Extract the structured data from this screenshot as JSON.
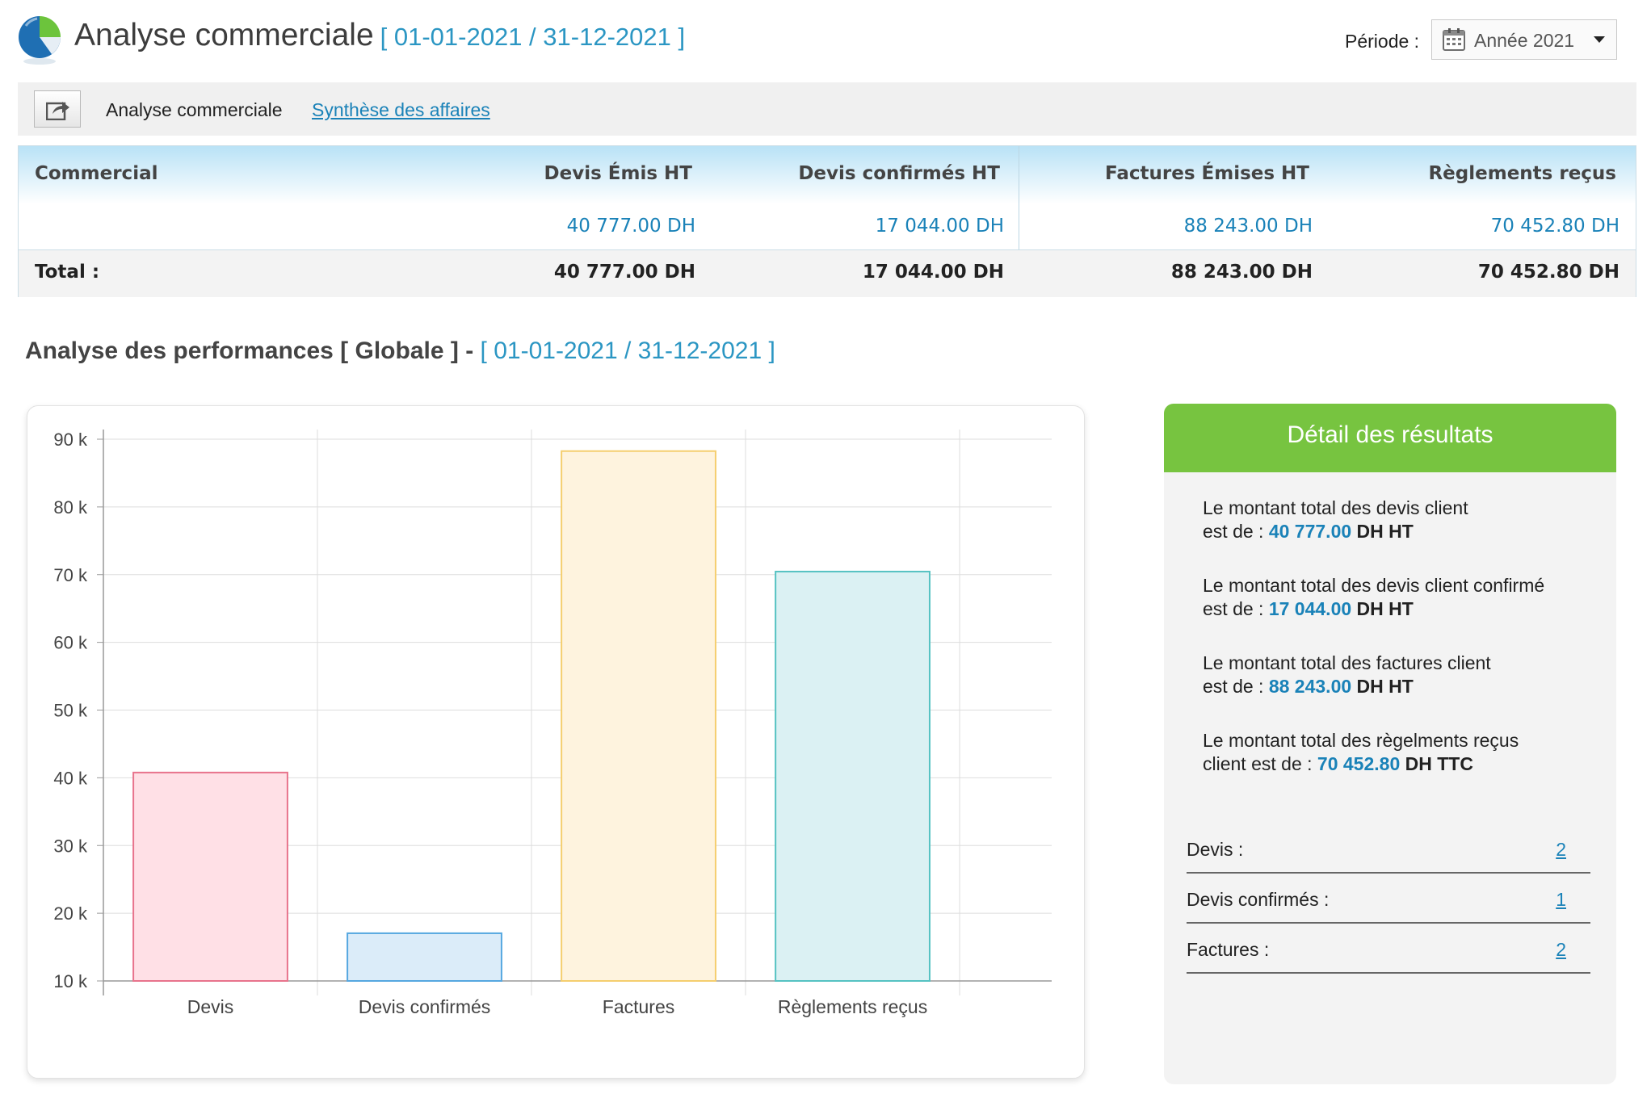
{
  "header": {
    "title": "Analyse commerciale",
    "date_range": "[ 01-01-2021 / 31-12-2021 ]",
    "period_label": "Période :",
    "period_value": "Année 2021"
  },
  "toolbar": {
    "current": "Analyse commerciale",
    "link": "Synthèse des affaires"
  },
  "table": {
    "headers": [
      "Commercial",
      "Devis Émis HT",
      "Devis confirmés HT",
      "Factures Émises HT",
      "Règlements reçus"
    ],
    "row": [
      "",
      "40 777.00 DH",
      "17 044.00 DH",
      "88 243.00 DH",
      "70 452.80 DH"
    ],
    "total": [
      "Total :",
      "40 777.00 DH",
      "17 044.00 DH",
      "88 243.00 DH",
      "70 452.80 DH"
    ]
  },
  "section": {
    "title": "Analyse des performances [ Globale ]",
    "dash": "-",
    "range": "[ 01-01-2021 / 31-12-2021 ]"
  },
  "chart_data": {
    "type": "bar",
    "categories": [
      "Devis",
      "Devis confirmés",
      "Factures",
      "Règlements reçus"
    ],
    "values": [
      40777,
      17044,
      88243,
      70452.8
    ],
    "ylim": [
      10000,
      90000
    ],
    "yticks": [
      10000,
      20000,
      30000,
      40000,
      50000,
      60000,
      70000,
      80000,
      90000
    ],
    "ytick_labels": [
      "10 k",
      "20 k",
      "30 k",
      "40 k",
      "50 k",
      "60 k",
      "70 k",
      "80 k",
      "90 k"
    ],
    "fill_colors": [
      "#ffe0e6",
      "#dbecf9",
      "#fef3de",
      "#dbf1f3"
    ],
    "stroke_colors": [
      "#e8738c",
      "#55a7e0",
      "#f5ce6e",
      "#55c2c2"
    ],
    "grid": true,
    "title": "",
    "xlabel": "",
    "ylabel": ""
  },
  "detail": {
    "title": "Détail des résultats",
    "sentences": [
      {
        "line1": "Le montant total des devis client",
        "line2_prefix": "est de :",
        "amount": "40 777.00",
        "unit": "DH HT"
      },
      {
        "line1": "Le montant total des devis client confirmé",
        "line2_prefix": "est de :",
        "amount": "17 044.00",
        "unit": "DH HT"
      },
      {
        "line1": "Le montant total des factures client",
        "line2_prefix": "est de :",
        "amount": "88 243.00",
        "unit": "DH HT"
      },
      {
        "line1": "Le montant total des règelments reçus",
        "line2_prefix": "client est de :",
        "amount": "70 452.80",
        "unit": "DH TTC"
      }
    ],
    "counts": [
      {
        "label": "Devis :",
        "value": "2"
      },
      {
        "label": "Devis confirmés :",
        "value": "1"
      },
      {
        "label": "Factures :",
        "value": "2"
      }
    ]
  },
  "colors": {
    "accent_blue": "#1a82b8",
    "range_blue": "#2b96c3",
    "panel_green": "#77c440"
  },
  "icons": [
    "pie-chart-logo-icon",
    "calendar-icon",
    "chevron-down-icon",
    "export-icon"
  ]
}
